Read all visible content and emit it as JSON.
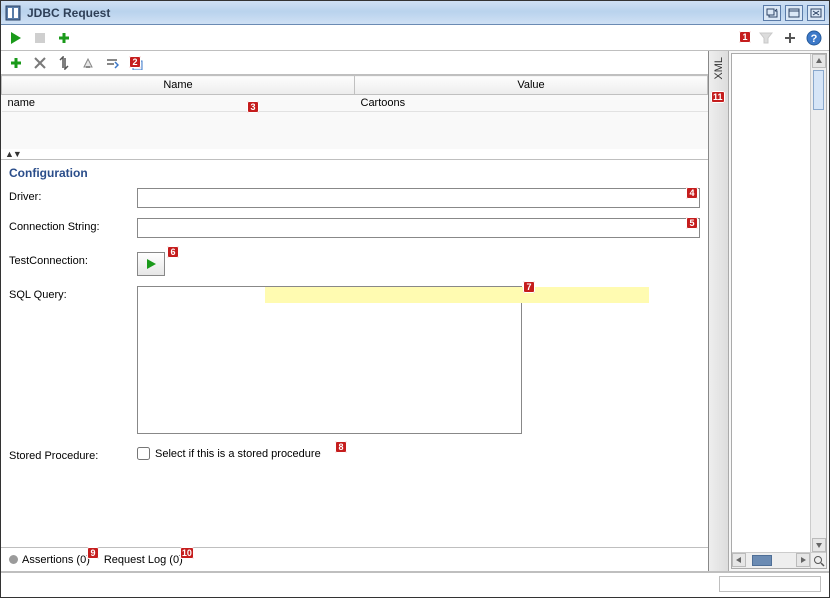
{
  "window": {
    "title": "JDBC Request"
  },
  "toolbar": {
    "run": "Run",
    "stop": "Stop",
    "add": "Add"
  },
  "badges": {
    "b1": "1",
    "b2": "2",
    "b3": "3",
    "b4": "4",
    "b5": "5",
    "b6": "6",
    "b7": "7",
    "b8": "8",
    "b9": "9",
    "b10": "10",
    "b11": "11"
  },
  "table": {
    "headers": {
      "name": "Name",
      "value": "Value"
    },
    "rows": [
      {
        "name": "name",
        "value": "Cartoons"
      }
    ]
  },
  "config": {
    "title": "Configuration",
    "driver_label": "Driver:",
    "driver_value": "",
    "conn_label": "Connection String:",
    "conn_value": "",
    "test_label": "TestConnection:",
    "sql_label": "SQL Query:",
    "sql_value": "",
    "sp_label": "Stored Procedure:",
    "sp_checkbox_label": "Select if this is a stored procedure"
  },
  "right": {
    "tab": "XML"
  },
  "bottom": {
    "assertions": "Assertions (0)",
    "request_log": "Request Log (0)"
  }
}
